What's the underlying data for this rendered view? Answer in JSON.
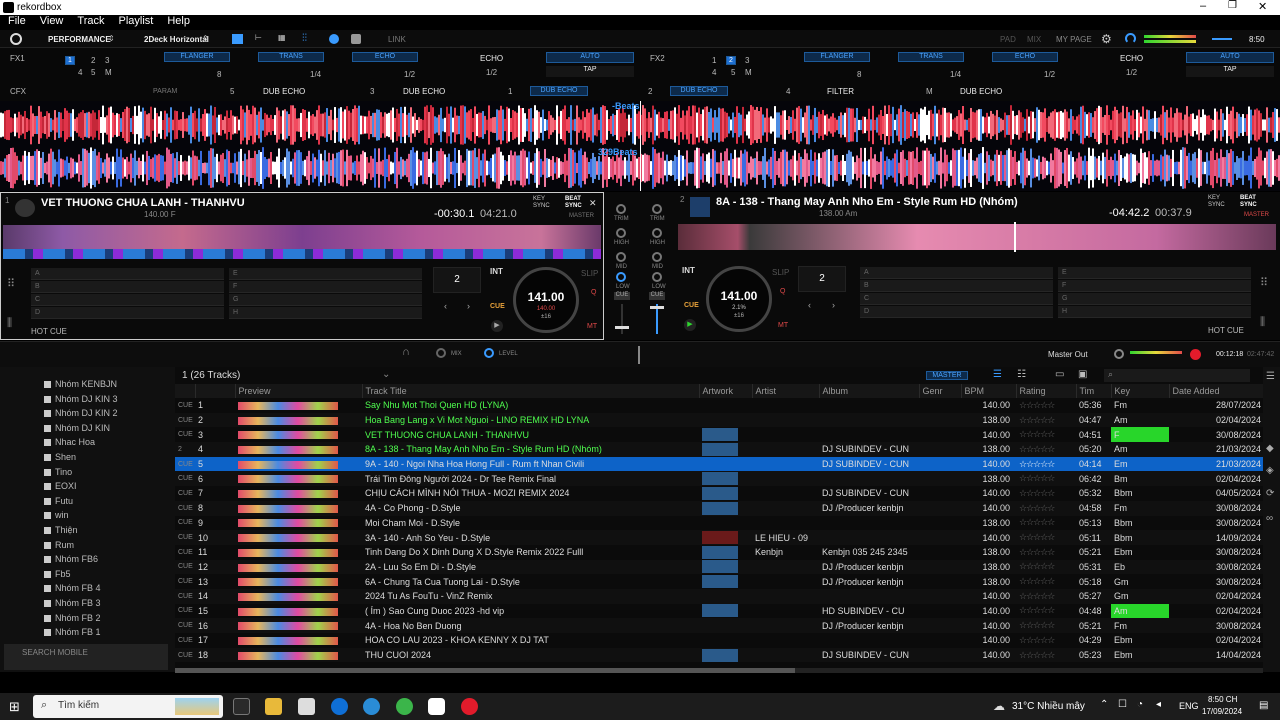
{
  "app": {
    "title": "rekordbox"
  },
  "menu": [
    "File",
    "View",
    "Track",
    "Playlist",
    "Help"
  ],
  "topbar": {
    "mode": "PERFORMANCE",
    "layout": "2Deck Horizontal",
    "link": "LINK",
    "tabs": [
      "PAD",
      "MIX"
    ],
    "mypage": "MY PAGE",
    "clock": "8:50"
  },
  "fx1": {
    "label": "FX1",
    "nums": [
      "1",
      "2",
      "3",
      "4",
      "5",
      "M"
    ],
    "effects": [
      "FLANGER",
      "TRANS",
      "ECHO"
    ],
    "beats": [
      "8",
      "1/4",
      "1/2"
    ],
    "main": "ECHO",
    "main_beat": "1/2",
    "auto": "AUTO",
    "tap": "TAP"
  },
  "fx2": {
    "label": "FX2",
    "nums": [
      "1",
      "2",
      "3",
      "4",
      "5",
      "M"
    ],
    "effects": [
      "FLANGER",
      "TRANS",
      "ECHO"
    ],
    "beats": [
      "8",
      "1/4",
      "1/2"
    ],
    "main": "ECHO",
    "main_beat": "1/2",
    "auto": "AUTO",
    "tap": "TAP"
  },
  "cfx": {
    "label": "CFX",
    "param": "PARAM",
    "slots": [
      {
        "n": "5",
        "name": "DUB ECHO"
      },
      {
        "n": "3",
        "name": "DUB ECHO"
      },
      {
        "n": "1",
        "name": "DUB ECHO"
      },
      {
        "n": "2",
        "name": "DUB ECHO"
      },
      {
        "n": "4",
        "name": "FILTER"
      },
      {
        "n": "M",
        "name": "DUB ECHO"
      }
    ]
  },
  "wave": {
    "beats_top": "-Beats",
    "beats_bottom": "329Beats"
  },
  "deck1": {
    "num": "1",
    "title": "VET THUONG CHUA LANH - THANHVU",
    "bpm_key": "140.00 F",
    "remain": "-00:30.1",
    "elapsed": "04:21.0",
    "key_sync": "KEY SYNC",
    "beat_sync": "BEAT SYNC",
    "master": "MASTER",
    "int": "INT",
    "slip": "SLIP",
    "cue": "CUE",
    "loop": "2",
    "jog_bpm": "141.00",
    "jog_sub": "140.00",
    "jog_range": "±16",
    "hotcue": "HOT CUE",
    "mt": "MT",
    "pads": [
      "A",
      "B",
      "C",
      "D",
      "E",
      "F",
      "G",
      "H"
    ]
  },
  "deck2": {
    "num": "2",
    "title": "8A - 138 - Thang May Anh Nho Em - Style Rum HD (Nhóm)",
    "bpm_key": "138.00 Am",
    "remain": "-04:42.2",
    "elapsed": "00:37.9",
    "key_sync": "KEY SYNC",
    "beat_sync": "BEAT SYNC",
    "master": "MASTER",
    "int": "INT",
    "slip": "SLIP",
    "cue": "CUE",
    "loop": "2",
    "jog_bpm": "141.00",
    "jog_sub": "2.1%",
    "jog_range": "±16",
    "hotcue": "HOT CUE",
    "mt": "MT",
    "pads": [
      "A",
      "B",
      "C",
      "D",
      "E",
      "F",
      "G",
      "H"
    ]
  },
  "mixer": {
    "trim": "TRIM",
    "high": "HIGH",
    "mid": "MID",
    "low": "LOW",
    "cue": "CUE"
  },
  "browser": {
    "mix": "MIX",
    "level": "LEVEL",
    "master_out": "Master Out",
    "time": "00:12:18",
    "time2": "02:47:42",
    "tracks_count": "1 (26 Tracks)",
    "master_btn": "MASTER"
  },
  "sidebar": {
    "items": [
      "Nhóm KENBJN",
      "Nhóm DJ KIN 3",
      "Nhóm DJ KIN 2",
      "Nhóm DJ KIN",
      "Nhac Hoa",
      "Shen",
      "Tino",
      "EOXI",
      "Futu",
      "win",
      "Thiện",
      "Rum",
      "Nhóm FB6",
      "Fb5",
      "Nhóm FB 4",
      "Nhóm FB 3",
      "Nhóm FB 2",
      "Nhóm FB 1"
    ],
    "search_mobile": "SEARCH MOBILE"
  },
  "table": {
    "headers": [
      "",
      "",
      "Preview",
      "Track Title",
      "Artwork",
      "Artist",
      "Album",
      "Genr",
      "BPM",
      "Rating",
      "Tim",
      "Key",
      "Date Added"
    ],
    "rows": [
      {
        "flag": "CUE",
        "n": "1",
        "title": "Say Nhu Mot Thoi Quen HD (LYNA)",
        "artist": "",
        "album": "",
        "bpm": "140.00",
        "time": "05:36",
        "key": "Fm",
        "date": "28/07/2024",
        "green": true,
        "kg": false
      },
      {
        "flag": "CUE",
        "n": "2",
        "title": "Hoa Bang Lang x Vi Mot Nguoi - LINO REMIX HD LYNA",
        "artist": "",
        "album": "",
        "bpm": "138.00",
        "time": "04:47",
        "key": "Am",
        "date": "02/04/2024",
        "green": true,
        "kg": true
      },
      {
        "flag": "CUE",
        "n": "3",
        "title": "VET THUONG CHUA LANH - THANHVU",
        "artist": "",
        "album": "",
        "bpm": "140.00",
        "time": "04:51",
        "key": "F",
        "date": "30/08/2024",
        "green": true,
        "kg": true
      },
      {
        "flag": "2",
        "n": "4",
        "title": "8A - 138 - Thang May Anh Nho Em - Style Rum HD (Nhóm)",
        "artist": "",
        "album": "DJ SUBINDEV - CUN",
        "bpm": "138.00",
        "time": "05:20",
        "key": "Am",
        "date": "21/03/2024",
        "green": true,
        "kg": true
      },
      {
        "flag": "CUE",
        "n": "5",
        "title": "9A - 140 - Ngoi Nha Hoa Hong Full - Rum ft Nhan Civili",
        "artist": "",
        "album": "DJ SUBINDEV - CUN",
        "bpm": "140.00",
        "time": "04:14",
        "key": "Em",
        "date": "21/03/2024",
        "green": false,
        "kg": true,
        "sel": true
      },
      {
        "flag": "CUE",
        "n": "6",
        "title": "Trái Tim Đông Người 2024 - Dr Tee Remix Final",
        "artist": "",
        "album": "",
        "bpm": "138.00",
        "time": "06:42",
        "key": "Bm",
        "date": "02/04/2024",
        "green": false,
        "kg": false
      },
      {
        "flag": "CUE",
        "n": "7",
        "title": "CHỊU CÁCH MÌNH NÓI THUA - MOZI REMIX 2024",
        "artist": "",
        "album": "DJ SUBINDEV - CUN",
        "bpm": "140.00",
        "time": "05:32",
        "key": "Bbm",
        "date": "04/05/2024",
        "green": false,
        "kg": false
      },
      {
        "flag": "CUE",
        "n": "8",
        "title": "4A - Co Phong - D.Style",
        "artist": "",
        "album": "DJ /Producer kenbjn",
        "bpm": "140.00",
        "time": "04:58",
        "key": "Fm",
        "date": "30/08/2024",
        "green": false,
        "kg": false
      },
      {
        "flag": "CUE",
        "n": "9",
        "title": "Moi Cham Moi - D.Style",
        "artist": "",
        "album": "",
        "bpm": "138.00",
        "time": "05:13",
        "key": "Bbm",
        "date": "30/08/2024",
        "green": false,
        "kg": false
      },
      {
        "flag": "CUE",
        "n": "10",
        "title": "3A - 140 - Anh So Yeu - D.Style",
        "artist": "LE HIEU - 09",
        "album": "",
        "bpm": "140.00",
        "time": "05:11",
        "key": "Bbm",
        "date": "14/09/2024",
        "green": false,
        "kg": false
      },
      {
        "flag": "CUE",
        "n": "11",
        "title": "Tinh Dang Do X Dinh Dung X D.Style Remix 2022 Fulll",
        "artist": "Kenbjn",
        "album": "Kenbjn 035 245 2345",
        "bpm": "138.00",
        "time": "05:21",
        "key": "Ebm",
        "date": "30/08/2024",
        "green": false,
        "kg": false
      },
      {
        "flag": "CUE",
        "n": "12",
        "title": "2A - Luu So Em Di - D.Style",
        "artist": "",
        "album": "DJ /Producer kenbjn",
        "bpm": "138.00",
        "time": "05:31",
        "key": "Eb",
        "date": "30/08/2024",
        "green": false,
        "kg": false
      },
      {
        "flag": "CUE",
        "n": "13",
        "title": "6A - Chung Ta Cua Tuong Lai - D.Style",
        "artist": "",
        "album": "DJ /Producer kenbjn",
        "bpm": "138.00",
        "time": "05:18",
        "key": "Gm",
        "date": "30/08/2024",
        "green": false,
        "kg": false
      },
      {
        "flag": "CUE",
        "n": "14",
        "title": "2024 Tu As FouTu - VinZ Remix",
        "artist": "",
        "album": "",
        "bpm": "140.00",
        "time": "05:27",
        "key": "Gm",
        "date": "02/04/2024",
        "green": false,
        "kg": false
      },
      {
        "flag": "CUE",
        "n": "15",
        "title": "( Ím ) Sao Cung Duoc 2023 -hd vip",
        "artist": "",
        "album": "HD SUBINDEV - CU",
        "bpm": "140.00",
        "time": "04:48",
        "key": "Am",
        "date": "02/04/2024",
        "green": false,
        "kg": true
      },
      {
        "flag": "CUE",
        "n": "16",
        "title": "4A - Hoa No Ben Duong",
        "artist": "",
        "album": "DJ /Producer kenbjn",
        "bpm": "140.00",
        "time": "05:21",
        "key": "Fm",
        "date": "30/08/2024",
        "green": false,
        "kg": false
      },
      {
        "flag": "CUE",
        "n": "17",
        "title": "HOA CO LAU 2023 - KHOA KENNY X DJ TAT",
        "artist": "",
        "album": "",
        "bpm": "140.00",
        "time": "04:29",
        "key": "Ebm",
        "date": "02/04/2024",
        "green": false,
        "kg": false
      },
      {
        "flag": "CUE",
        "n": "18",
        "title": "THU CUOI 2024",
        "artist": "",
        "album": "DJ SUBINDEV - CUN",
        "bpm": "140.00",
        "time": "05:23",
        "key": "Ebm",
        "date": "14/04/2024",
        "green": false,
        "kg": false
      }
    ]
  },
  "taskbar": {
    "search": "Tìm kiếm",
    "weather": "31°C  Nhiều mây",
    "lang": "ENG",
    "time": "8:50 CH",
    "date": "17/09/2024"
  },
  "colors": {
    "accent": "#3a9bff",
    "selected": "#0d63c8",
    "played": "#4fff4f",
    "key_highlight": "#28d62a"
  }
}
